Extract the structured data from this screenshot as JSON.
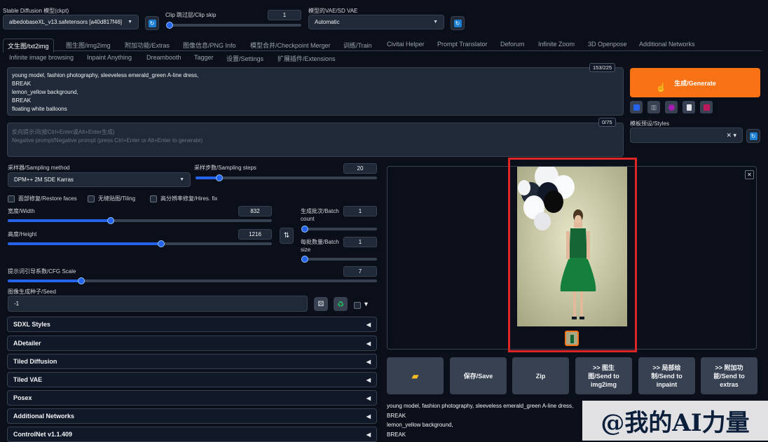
{
  "header": {
    "ckpt_label": "Stable Diffusion 模型(ckpt)",
    "ckpt_value": "albedobaseXL_v13.safetensors [a40d817f46]",
    "clip_label": "Clip 跳过层/Clip skip",
    "clip_value": "1",
    "vae_label": "模型的VAE/SD VAE",
    "vae_value": "Automatic"
  },
  "tabs_row1": [
    "文生图/txt2img",
    "图生图/img2img",
    "附加功能/Extras",
    "图像信息/PNG Info",
    "模型合并/Checkpoint Merger",
    "训练/Train",
    "Civitai Helper",
    "Prompt Translator",
    "Deforum",
    "Infinite Zoom",
    "3D Openpose",
    "Additional Networks"
  ],
  "tabs_row2": [
    "Infinite image browsing",
    "Inpaint Anything",
    "Dreambooth",
    "Tagger",
    "设置/Settings",
    "扩展插件/Extensions"
  ],
  "prompt": {
    "lines": [
      "young model, fashion photography, sleeveless emerald_green A-line dress,",
      "BREAK",
      "lemon_yellow background,",
      "BREAK",
      "floating white balloons"
    ],
    "counter": "153/225"
  },
  "negative": {
    "placeholder_line1": "反向提示词(按Ctrl+Enter或Alt+Enter生成)",
    "placeholder_line2": "Negative prompt/Negative prompt (press Ctrl+Enter or Alt+Enter to generate)",
    "counter": "0/75"
  },
  "generate": {
    "label": "生成/Generate",
    "styles_label": "模板预设/Styles"
  },
  "sampling": {
    "method_label": "采样器/Sampling method",
    "method_value": "DPM++ 2M SDE Karras",
    "steps_label": "采样步数/Sampling steps",
    "steps_value": "20",
    "steps_fraction": 0.13
  },
  "checkboxes": [
    "面部修复/Restore faces",
    "无缝贴图/Tiling",
    "高分辨率修复/Hires. fix"
  ],
  "size": {
    "width_label": "宽度/Width",
    "width_value": "832",
    "width_fraction": 0.39,
    "height_label": "高度/Height",
    "height_value": "1216",
    "height_fraction": 0.58
  },
  "batch": {
    "count_label_line1": "生成批次/Batch",
    "count_label_line2": "count",
    "count_value": "1",
    "size_label_line1": "每批数量/Batch",
    "size_label_line2": "size",
    "size_value": "1"
  },
  "cfg": {
    "label": "提示词引导系数/CFG Scale",
    "value": "7",
    "fraction": 0.2
  },
  "seed": {
    "label": "图像生成种子/Seed",
    "value": "-1"
  },
  "accordions": [
    "SDXL Styles",
    "ADetailer",
    "Tiled Diffusion",
    "Tiled VAE",
    "Posex",
    "Additional Networks",
    "ControlNet v1.1.409"
  ],
  "actions": [
    {
      "icon": "folder-icon",
      "label": ""
    },
    {
      "icon": "",
      "label": "保存/Save"
    },
    {
      "icon": "",
      "label": "Zip"
    },
    {
      "icon": "",
      "label": ">> 图生\n图/Send to\nimg2img"
    },
    {
      "icon": "",
      "label": ">> 局部绘\n制/Send to\ninpaint"
    },
    {
      "icon": "",
      "label": ">> 附加功\n能/Send to\nextras"
    }
  ],
  "output_info": [
    "young model, fashion photography, sleeveless emerald_green A-line dress,",
    "BREAK",
    "lemon_yellow background,",
    "BREAK"
  ],
  "watermark": "@我的AI力量",
  "colors": {
    "generate": "#f97316",
    "accent": "#2563eb",
    "highlight_box": "#dc2626",
    "dress": "#166534"
  }
}
